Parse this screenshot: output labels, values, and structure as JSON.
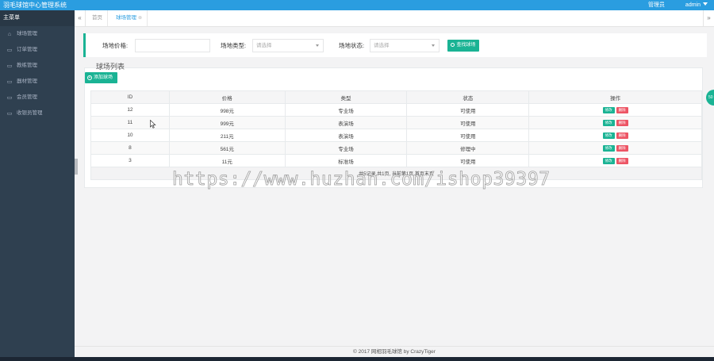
{
  "app": {
    "title": "羽毛球馆中心管理系统",
    "admin_menu": "管理员",
    "user": "admin"
  },
  "sidebar": {
    "heading": "主菜单",
    "items": [
      {
        "label": "球场管理",
        "icon": "home-icon"
      },
      {
        "label": "订单管理",
        "icon": "document-icon"
      },
      {
        "label": "教练管理",
        "icon": "document-icon"
      },
      {
        "label": "器材管理",
        "icon": "document-icon"
      },
      {
        "label": "会员管理",
        "icon": "document-icon"
      },
      {
        "label": "收银员管理",
        "icon": "document-icon"
      }
    ]
  },
  "tabs": {
    "prev": "«",
    "next": "»",
    "home": "首页",
    "active": "球场管理",
    "close_glyph": "⊗"
  },
  "filter": {
    "price_label": "场地价格:",
    "price_value": "",
    "type_label": "场地类型:",
    "type_placeholder": "请选择",
    "status_label": "场地状态:",
    "status_placeholder": "请选择",
    "search_button": "查找球场"
  },
  "list": {
    "title": "球场列表",
    "add_button": "添加球场",
    "columns": [
      "ID",
      "价格",
      "类型",
      "状态",
      "操作"
    ],
    "rows": [
      {
        "id": "12",
        "price": "998元",
        "type": "专业场",
        "status": "可使用"
      },
      {
        "id": "11",
        "price": "999元",
        "type": "表演场",
        "status": "可使用"
      },
      {
        "id": "10",
        "price": "211元",
        "type": "表演场",
        "status": "可使用"
      },
      {
        "id": "8",
        "price": "561元",
        "type": "专业场",
        "status": "修理中"
      },
      {
        "id": "3",
        "price": "11元",
        "type": "标准场",
        "status": "可使用"
      }
    ],
    "edit_label": "修改",
    "delete_label": "删除",
    "pager_text": "共5记录,共1页, 当前第1页 首页",
    "pager_last": "末页"
  },
  "float_badge": "50",
  "watermark": "https://www.huzhan.com/ishop39397",
  "footer": "© 2017 网相羽毛球馆 by CrazyTiger",
  "colors": {
    "topbar": "#2a9de0",
    "sidebar": "#2f4050",
    "accent": "#1ab394",
    "danger": "#ed5565"
  }
}
